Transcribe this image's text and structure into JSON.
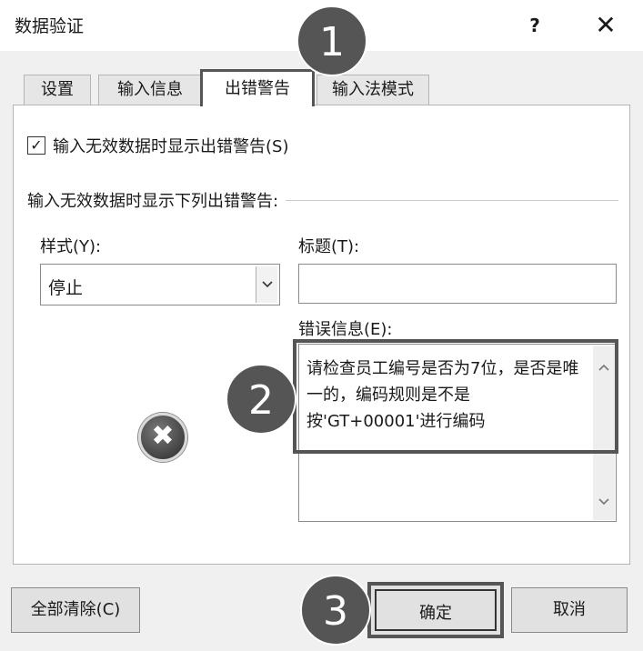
{
  "dialog": {
    "title": "数据验证",
    "help_label": "?",
    "close_label": "✕"
  },
  "tabs": [
    {
      "label": "设置"
    },
    {
      "label": "输入信息"
    },
    {
      "label": "出错警告",
      "active": true
    },
    {
      "label": "输入法模式"
    }
  ],
  "error_alert": {
    "show_alert_label": "输入无效数据时显示出错警告(S)",
    "show_alert_checked": true,
    "section_label": "输入无效数据时显示下列出错警告:",
    "style_label": "样式(Y):",
    "style_value": "停止",
    "title_label": "标题(T):",
    "title_value": "",
    "message_label": "错误信息(E):",
    "message_value": "请检查员工编号是否为7位，是否是唯一的，编码规则是不是按'GT+00001'进行编码"
  },
  "icons": {
    "stop_icon": "✖",
    "checkbox_check": "☑",
    "dropdown_arrow": "⌵",
    "scroll_up": "▲",
    "scroll_down": "▼"
  },
  "markers": [
    "1",
    "2",
    "3"
  ],
  "buttons": {
    "clear_all": "全部清除(C)",
    "ok": "确定",
    "cancel": "取消"
  },
  "colors": {
    "marker": "#555555",
    "highlight_border": "#555555",
    "panel": "#ffffff",
    "dialog_bg": "#f0f0f0"
  }
}
